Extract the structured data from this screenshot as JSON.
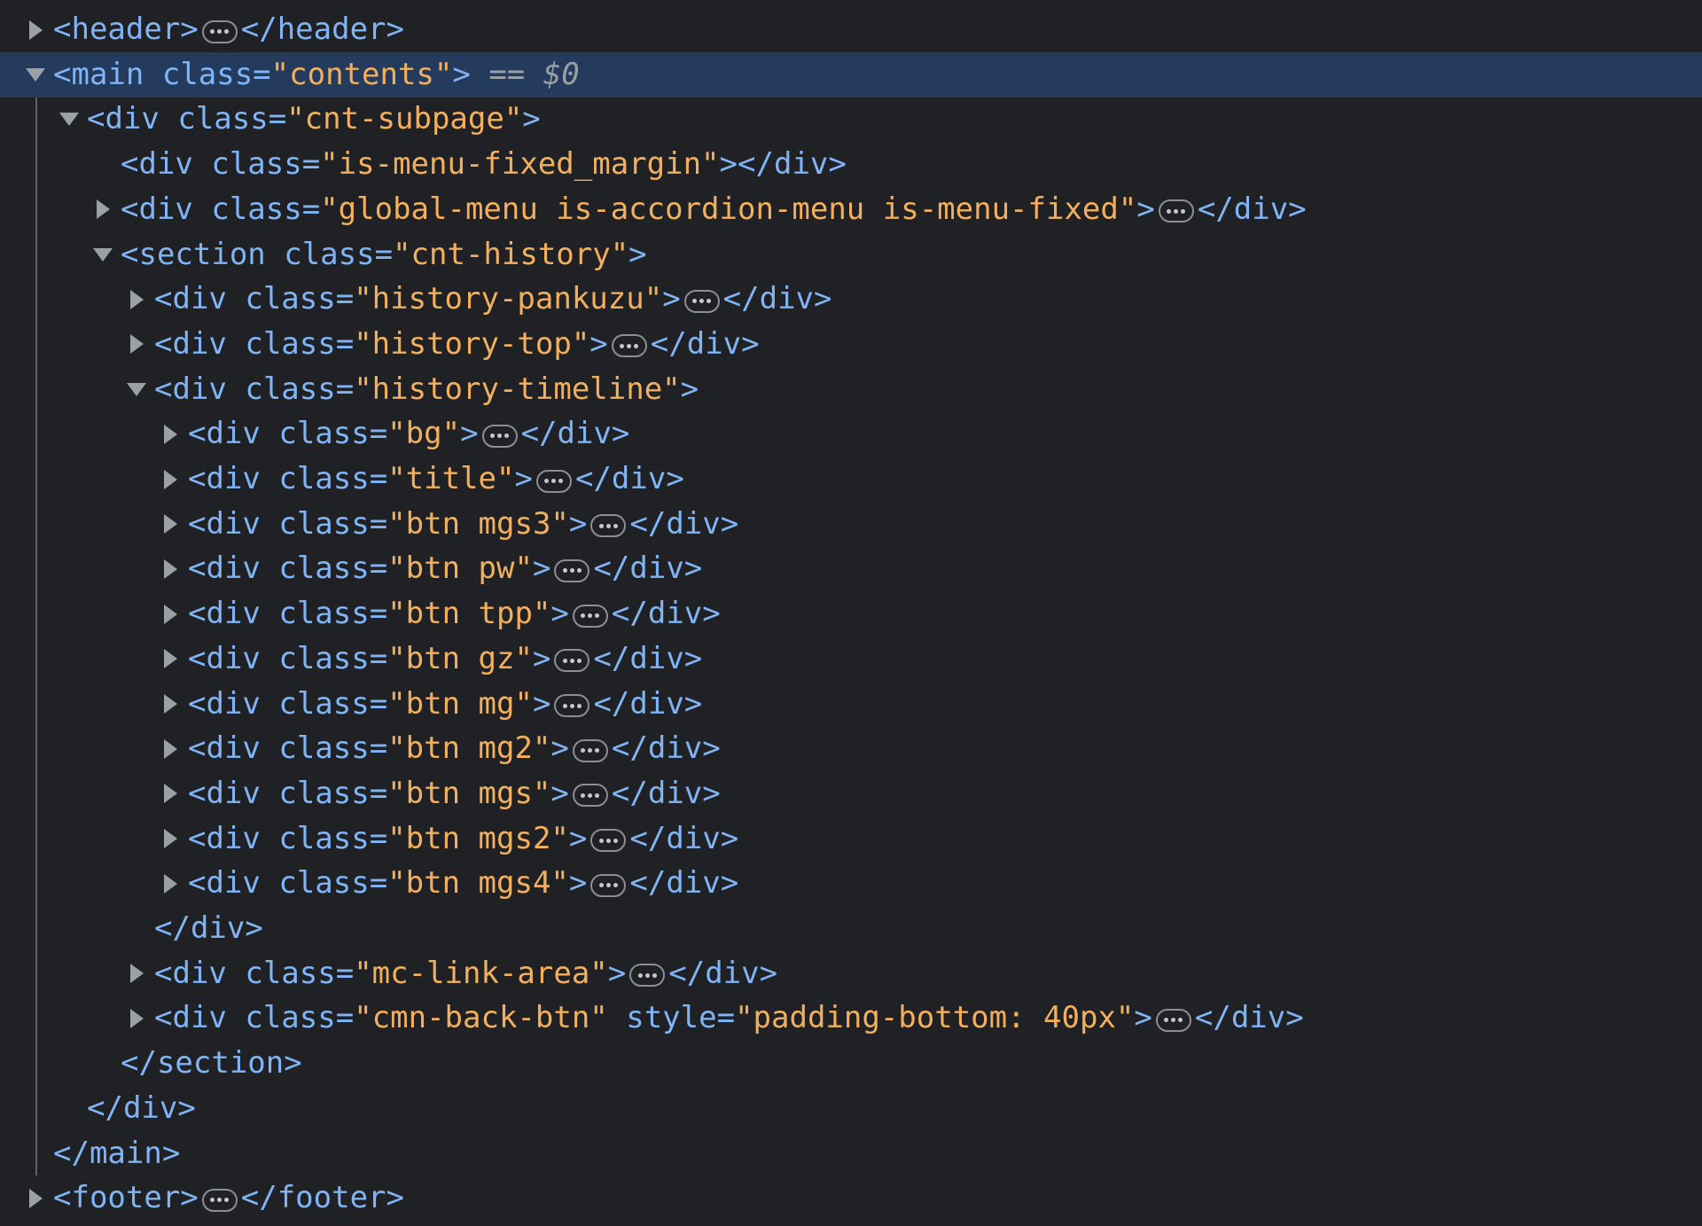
{
  "panel": "elements",
  "selected_suffix": "== $0",
  "nodes": [
    {
      "depth": 0,
      "kind": "collapsed",
      "parts": [
        "<header>",
        "…",
        "</header>"
      ],
      "text_open": "<header>",
      "text_close": "</header>"
    },
    {
      "depth": 0,
      "kind": "open",
      "selected": true,
      "tag_open": "<main ",
      "attr": "class=",
      "value": "\"contents\"",
      "tag_end": ">",
      "marker": " == ",
      "dollar": "$0"
    },
    {
      "depth": 1,
      "kind": "open",
      "tag_open": "<div ",
      "attr": "class=",
      "value": "\"cnt-subpage\"",
      "tag_end": ">"
    },
    {
      "depth": 2,
      "kind": "leaf",
      "tag_open": "<div ",
      "attr": "class=",
      "value": "\"is-menu-fixed_margin\"",
      "tag_end": "></div>"
    },
    {
      "depth": 2,
      "kind": "collapsed",
      "tag_open": "<div ",
      "attr": "class=",
      "value": "\"global-menu is-accordion-menu is-menu-fixed\"",
      "tag_end": ">",
      "close": "</div>"
    },
    {
      "depth": 2,
      "kind": "open",
      "tag_open": "<section ",
      "attr": "class=",
      "value": "\"cnt-history\"",
      "tag_end": ">"
    },
    {
      "depth": 3,
      "kind": "collapsed",
      "tag_open": "<div ",
      "attr": "class=",
      "value": "\"history-pankuzu\"",
      "tag_end": ">",
      "close": "</div>"
    },
    {
      "depth": 3,
      "kind": "collapsed",
      "tag_open": "<div ",
      "attr": "class=",
      "value": "\"history-top\"",
      "tag_end": ">",
      "close": "</div>"
    },
    {
      "depth": 3,
      "kind": "open",
      "tag_open": "<div ",
      "attr": "class=",
      "value": "\"history-timeline\"",
      "tag_end": ">"
    },
    {
      "depth": 4,
      "kind": "collapsed",
      "tag_open": "<div ",
      "attr": "class=",
      "value": "\"bg\"",
      "tag_end": ">",
      "close": "</div>"
    },
    {
      "depth": 4,
      "kind": "collapsed",
      "tag_open": "<div ",
      "attr": "class=",
      "value": "\"title\"",
      "tag_end": ">",
      "close": "</div>"
    },
    {
      "depth": 4,
      "kind": "collapsed",
      "tag_open": "<div ",
      "attr": "class=",
      "value": "\"btn mgs3\"",
      "tag_end": ">",
      "close": "</div>"
    },
    {
      "depth": 4,
      "kind": "collapsed",
      "tag_open": "<div ",
      "attr": "class=",
      "value": "\"btn pw\"",
      "tag_end": ">",
      "close": "</div>"
    },
    {
      "depth": 4,
      "kind": "collapsed",
      "tag_open": "<div ",
      "attr": "class=",
      "value": "\"btn tpp\"",
      "tag_end": ">",
      "close": "</div>"
    },
    {
      "depth": 4,
      "kind": "collapsed",
      "tag_open": "<div ",
      "attr": "class=",
      "value": "\"btn gz\"",
      "tag_end": ">",
      "close": "</div>"
    },
    {
      "depth": 4,
      "kind": "collapsed",
      "tag_open": "<div ",
      "attr": "class=",
      "value": "\"btn mg\"",
      "tag_end": ">",
      "close": "</div>"
    },
    {
      "depth": 4,
      "kind": "collapsed",
      "tag_open": "<div ",
      "attr": "class=",
      "value": "\"btn mg2\"",
      "tag_end": ">",
      "close": "</div>"
    },
    {
      "depth": 4,
      "kind": "collapsed",
      "tag_open": "<div ",
      "attr": "class=",
      "value": "\"btn mgs\"",
      "tag_end": ">",
      "close": "</div>"
    },
    {
      "depth": 4,
      "kind": "collapsed",
      "tag_open": "<div ",
      "attr": "class=",
      "value": "\"btn mgs2\"",
      "tag_end": ">",
      "close": "</div>"
    },
    {
      "depth": 4,
      "kind": "collapsed",
      "tag_open": "<div ",
      "attr": "class=",
      "value": "\"btn mgs4\"",
      "tag_end": ">",
      "close": "</div>"
    },
    {
      "depth": 3,
      "kind": "closing",
      "text": "</div>"
    },
    {
      "depth": 3,
      "kind": "collapsed",
      "tag_open": "<div ",
      "attr": "class=",
      "value": "\"mc-link-area\"",
      "tag_end": ">",
      "close": "</div>"
    },
    {
      "depth": 3,
      "kind": "collapsed",
      "tag_open": "<div ",
      "attr": "class=",
      "value": "\"cmn-back-btn\"",
      "attr2": " style=",
      "value2": "\"padding-bottom: 40px\"",
      "tag_end": ">",
      "close": "</div>"
    },
    {
      "depth": 2,
      "kind": "closing",
      "text": "</section>"
    },
    {
      "depth": 1,
      "kind": "closing",
      "text": "</div>"
    },
    {
      "depth": 0,
      "kind": "closing",
      "text": "</main>"
    },
    {
      "depth": 0,
      "kind": "collapsed",
      "text_open": "<footer>",
      "text_close": "</footer>"
    }
  ],
  "icons": {
    "expand": "triangle-right-icon",
    "collapse": "triangle-down-icon",
    "ellipsis": "ellipsis-icon"
  }
}
